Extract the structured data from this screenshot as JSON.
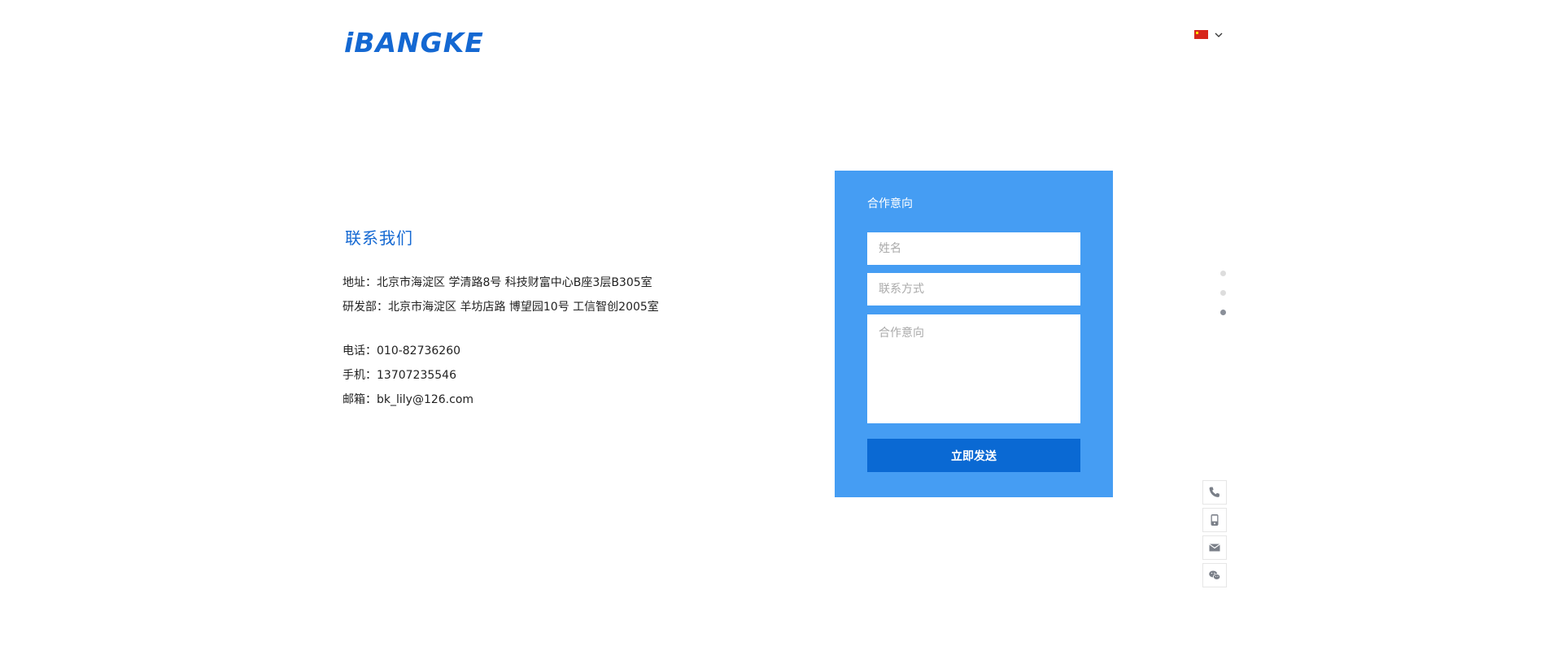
{
  "header": {
    "logo_text": "iBANGKE",
    "language": "中文"
  },
  "contact": {
    "title": "联系我们",
    "address": "地址：北京市海淀区 学清路8号 科技财富中心B座3层B305室",
    "rnd": "研发部：北京市海淀区 羊坊店路 博望园10号 工信智创2005室",
    "phone": "电话：010-82736260",
    "mobile": "手机：13707235546",
    "email": "邮箱：bk_lily@126.com"
  },
  "form": {
    "title": "合作意向",
    "name_placeholder": "姓名",
    "contact_placeholder": "联系方式",
    "intent_placeholder": "合作意向",
    "submit_label": "立即发送"
  },
  "page_dots": {
    "count": 3,
    "active_index": 2
  },
  "side_tools": [
    "phone-icon",
    "mobile-icon",
    "mail-icon",
    "wechat-icon"
  ],
  "colors": {
    "brand": "#1468d2",
    "form_bg": "#459df3",
    "button_bg": "#0a69d3"
  }
}
